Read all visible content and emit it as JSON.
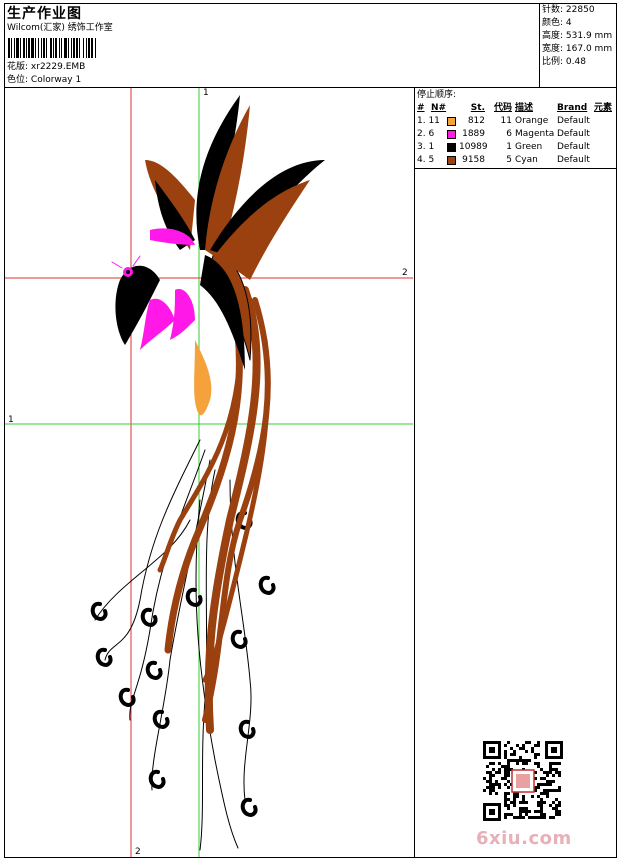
{
  "header": {
    "title": "生产作业图",
    "company": "Wilcom(汇家) 绣饰工作室",
    "design_label": "花版:",
    "design_file": "xr2229.EMB",
    "colorway_label": "色位:",
    "colorway": "Colorway 1"
  },
  "stats": [
    {
      "label": "针数:",
      "value": "22850"
    },
    {
      "label": "颜色:",
      "value": "4"
    },
    {
      "label": "高度:",
      "value": "531.9 mm"
    },
    {
      "label": "宽度:",
      "value": "167.0 mm"
    },
    {
      "label": "比例:",
      "value": "0.48"
    }
  ],
  "legend": {
    "heading": "停止顺序:",
    "columns": {
      "num": "#",
      "needle": "N#",
      "stitches": "St.",
      "code": "代码",
      "desc": "描述",
      "brand": "Brand",
      "element": "元素"
    },
    "rows": [
      {
        "num": "1. 11",
        "color": "#f5a23c",
        "stitches": "812",
        "code": "11",
        "desc": "Orange",
        "brand": "Default"
      },
      {
        "num": "2. 6",
        "color": "#ff18e8",
        "stitches": "1889",
        "code": "6",
        "desc": "Magenta",
        "brand": "Default"
      },
      {
        "num": "3. 1",
        "color": "#000000",
        "stitches": "10989",
        "code": "1",
        "desc": "Green",
        "brand": "Default"
      },
      {
        "num": "4. 5",
        "color": "#9b4110",
        "stitches": "9158",
        "code": "5",
        "desc": "Cyan",
        "brand": "Default"
      }
    ]
  },
  "guides": {
    "v_green_label": "1",
    "h_red_label": "2",
    "h_green_label": "1",
    "v_red_label": "2"
  },
  "colors": {
    "guide_red": "#e03030",
    "guide_green": "#30d030",
    "thread_brown": "#9b4110",
    "thread_black": "#000000",
    "thread_magenta": "#ff18e8",
    "thread_orange": "#f5a23c"
  },
  "watermark": "6xiu.com"
}
